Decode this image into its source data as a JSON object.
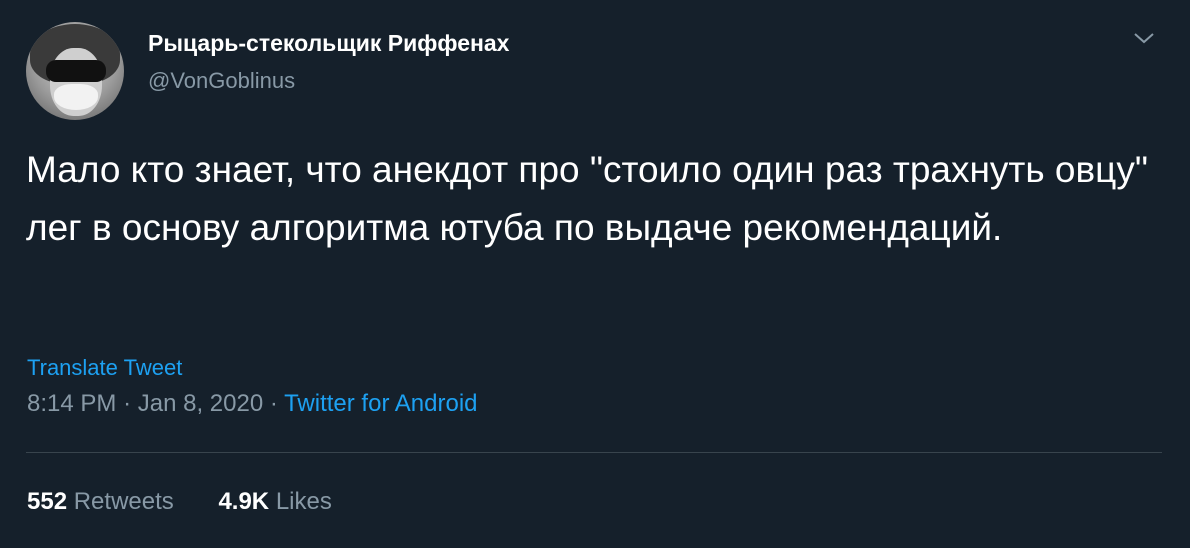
{
  "author": {
    "display_name": "Рыцарь-стекольщик Риффенах",
    "handle": "@VonGoblinus"
  },
  "tweet": {
    "text": "Мало кто знает, что анекдот про \"стоило один раз трахнуть овцу\" лег в основу алгоритма ютуба по выдаче рекомендаций.",
    "translate_label": "Translate Tweet",
    "time": "8:14 PM",
    "date": "Jan 8, 2020",
    "separator": "·",
    "source": "Twitter for Android"
  },
  "stats": {
    "retweets_count": "552",
    "retweets_label": "Retweets",
    "likes_count": "4.9K",
    "likes_label": "Likes"
  },
  "icons": {
    "menu": "chevron-down-icon"
  },
  "colors": {
    "background": "#15202b",
    "text": "#ffffff",
    "secondary": "#8899a6",
    "accent": "#1da1f2",
    "divider": "#38444d"
  }
}
